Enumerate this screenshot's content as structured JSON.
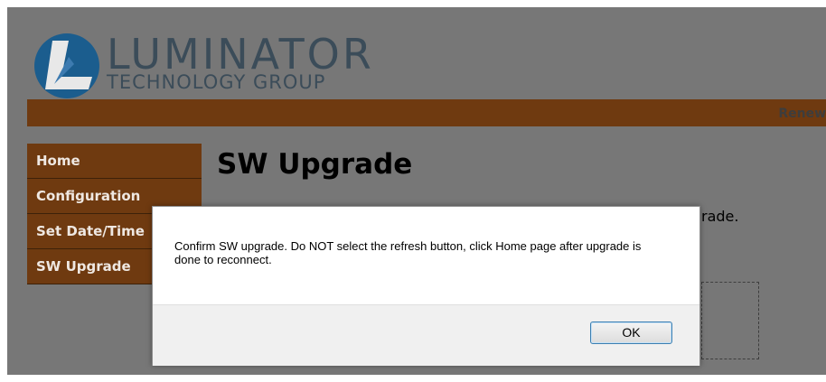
{
  "brand": {
    "logo_main": "LUMINATOR",
    "logo_sub": "TECHNOLOGY GROUP",
    "logo_circle_color": "#1b5d8e"
  },
  "topbar": {
    "renew_label": "Renew"
  },
  "sidebar": {
    "items": [
      {
        "label": "Home"
      },
      {
        "label": "Configuration"
      },
      {
        "label": "Set Date/Time"
      },
      {
        "label": "SW Upgrade"
      }
    ]
  },
  "main": {
    "title": "SW Upgrade",
    "obscured_text_fragment": "rade."
  },
  "dialog": {
    "message": "Confirm SW upgrade. Do NOT select the refresh button, click Home page after upgrade is done to reconnect.",
    "ok_label": "OK"
  },
  "colors": {
    "nav_brown": "#6f3a10",
    "overlay_gray": "#777777",
    "button_focus": "#3c7fb1"
  }
}
